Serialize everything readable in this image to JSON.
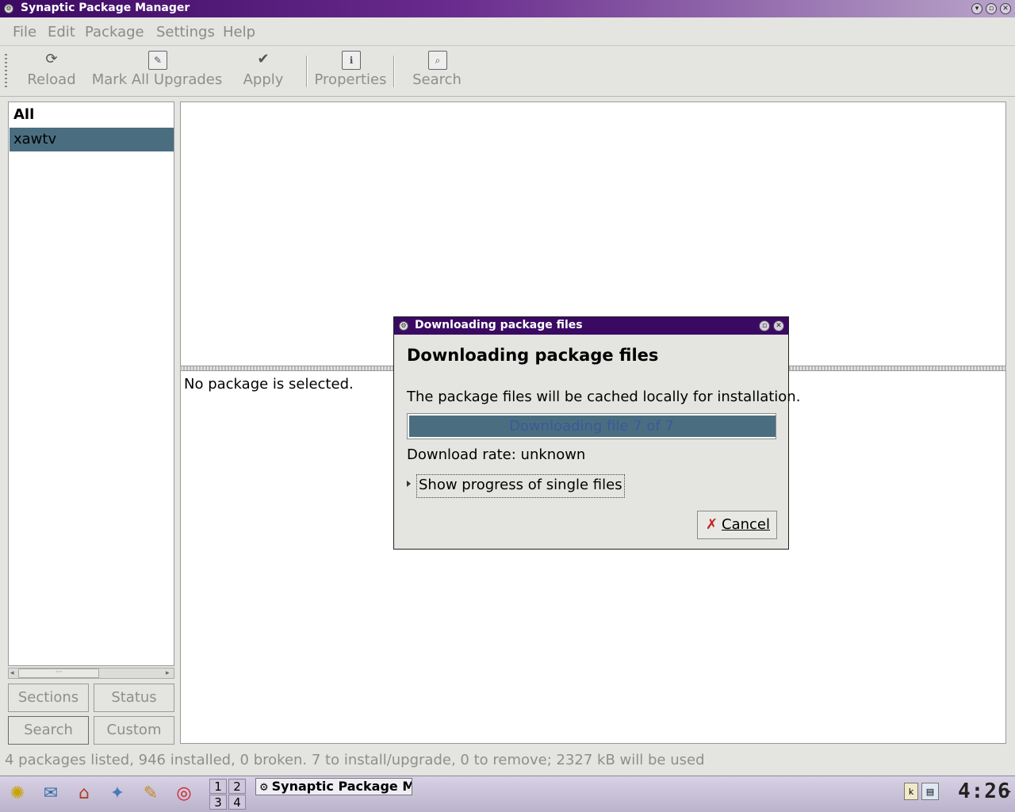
{
  "window": {
    "title": "Synaptic Package Manager"
  },
  "menu": [
    "File",
    "Edit",
    "Package",
    "Settings",
    "Help"
  ],
  "toolbar": {
    "reload": "Reload",
    "mark_all": "Mark All Upgrades",
    "apply": "Apply",
    "properties": "Properties",
    "search": "Search"
  },
  "filters": {
    "items": [
      "All",
      "xawtv"
    ]
  },
  "left_buttons": {
    "sections": "Sections",
    "status": "Status",
    "search": "Search",
    "custom": "Custom"
  },
  "details": {
    "text": "No package is selected."
  },
  "statusbar": {
    "text": "4 packages listed, 946 installed, 0 broken. 7 to install/upgrade, 0 to remove; 2327 kB will be used"
  },
  "dialog": {
    "title": "Downloading package files",
    "heading": "Downloading package files",
    "message": "The package files will be cached locally for installation.",
    "progress_text": "Downloading file 7 of 7",
    "progress_fraction": 1.0,
    "rate": "Download rate: unknown",
    "expander": "Show progress of single files",
    "cancel": "Cancel"
  },
  "taskbar": {
    "pager": [
      "1",
      "2",
      "3",
      "4"
    ],
    "task": "Synaptic Package Man",
    "clock": "4:26"
  },
  "colors": {
    "titlebar": "#3c0a62",
    "selection": "#4a6e80"
  }
}
